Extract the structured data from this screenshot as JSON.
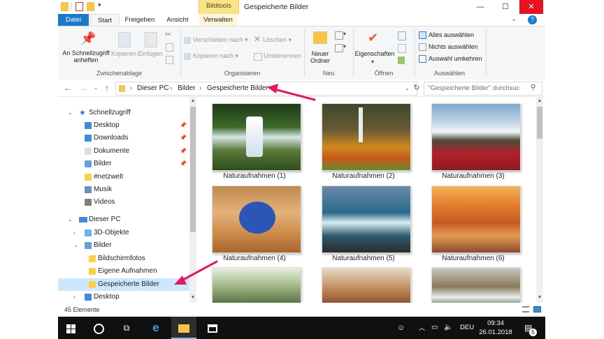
{
  "window": {
    "title": "Gespeicherte Bilder",
    "contextual_tab": "Bildtools",
    "controls": {
      "minimize": "—",
      "maximize": "☐",
      "close": "✕"
    }
  },
  "tabs": [
    "Datei",
    "Start",
    "Freigeben",
    "Ansicht",
    "Verwalten"
  ],
  "ribbon": {
    "groups": {
      "clipboard": "Zwischenablage",
      "organize": "Organisieren",
      "new": "Neu",
      "open": "Öffnen",
      "select": "Auswählen"
    },
    "pin_label_1": "An Schnellzugriff",
    "pin_label_2": "anheften",
    "copy": "Kopieren",
    "paste": "Einfügen",
    "move_to": "Verschieben nach",
    "copy_to": "Kopieren nach",
    "delete": "Löschen",
    "rename": "Umbenennen",
    "new_folder_1": "Neuer",
    "new_folder_2": "Ordner",
    "properties": "Eigenschaften",
    "select_all": "Alles auswählen",
    "select_none": "Nichts auswählen",
    "invert_selection": "Auswahl umkehren"
  },
  "address": {
    "crumbs": [
      "Dieser PC",
      "Bilder",
      "Gespeicherte Bilder"
    ],
    "search_placeholder": "\"Gespeicherte Bilder\" durchsuc"
  },
  "nav": {
    "quick_access": "Schnellzugriff",
    "quick_items": [
      "Desktop",
      "Downloads",
      "Dokumente",
      "Bilder",
      "#netzwelt",
      "Musik",
      "Videos"
    ],
    "this_pc": "Dieser PC",
    "pc_items": [
      "3D-Objekte",
      "Bilder"
    ],
    "pictures_children": [
      "Bildschirmfotos",
      "Eigene Aufnahmen",
      "Gespeicherte Bilder"
    ],
    "after": "Desktop"
  },
  "files": [
    "Naturaufnahmen (1)",
    "Naturaufnahmen (2)",
    "Naturaufnahmen (3)",
    "Naturaufnahmen (4)",
    "Naturaufnahmen (5)",
    "Naturaufnahmen (6)"
  ],
  "status": {
    "count": "45 Elemente"
  },
  "taskbar": {
    "time": "09:34",
    "date": "26.01.2018",
    "lang": "DEU",
    "notifications": "5"
  },
  "colors": {
    "accent": "#1979ca",
    "selection": "#cce8ff",
    "arrow": "#e8175d",
    "contextual": "#f7e48a"
  }
}
